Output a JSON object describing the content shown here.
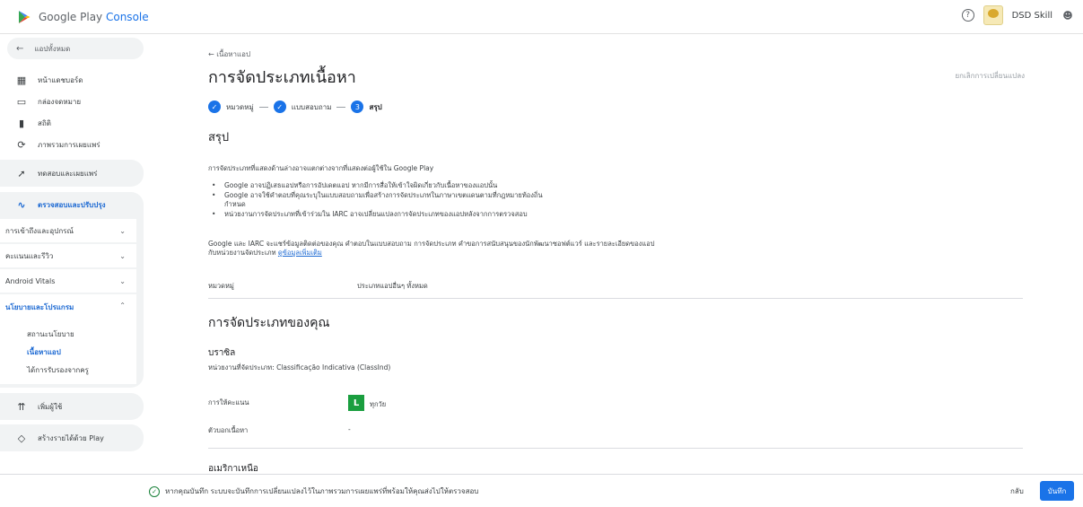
{
  "app": {
    "brand": "Google Play ",
    "brand_accent": "Console"
  },
  "account": {
    "name": "DSD Skill"
  },
  "sidebar": {
    "back_label": "แอปทั้งหมด",
    "items": [
      {
        "label": "หน้าแดชบอร์ด",
        "icon": "dashboard-icon"
      },
      {
        "label": "กล่องจดหมาย",
        "icon": "inbox-icon"
      },
      {
        "label": "สถิติ",
        "icon": "stats-icon"
      },
      {
        "label": "ภาพรวมการเผยแพร่",
        "icon": "publishing-overview-icon"
      }
    ],
    "test_release": "ทดสอบและเผยแพร่",
    "monitor_improve": "ตรวจสอบและปรับปรุง",
    "reach_devices": "การเข้าถึงและอุปกรณ์",
    "ratings_reviews": "คะแนนและรีวิว",
    "android_vitals": "Android Vitals",
    "policy_programs": "นโยบายและโปรแกรม",
    "policy_status": "สถานะนโยบาย",
    "app_content": "เนื้อหาแอป",
    "teacher_approved": "ได้การรับรองจากครู",
    "grow_users": "เพิ่มผู้ใช้",
    "monetize": "สร้างรายได้ด้วย Play"
  },
  "main": {
    "breadcrumb": "เนื้อหาแอป",
    "title": "การจัดประเภทเนื้อหา",
    "discard": "ยกเลิกการเปลี่ยนแปลง",
    "steps": [
      {
        "label": "หมวดหมู่",
        "state": "done"
      },
      {
        "label": "แบบสอบถาม",
        "state": "done"
      },
      {
        "label": "สรุป",
        "state": "current",
        "number": "3"
      }
    ],
    "summary_title": "สรุป",
    "intro": "การจัดประเภทที่แสดงด้านล่างอาจแตกต่างจากที่แสดงต่อผู้ใช้ใน Google Play",
    "bullets": [
      "Google อาจปฏิเสธแอปหรือการอัปเดตแอป หากมีการสื่อให้เข้าใจผิดเกี่ยวกับเนื้อหาของแอปนั้น",
      "Google อาจใช้คำตอบที่คุณระบุในแบบสอบถามเพื่อสร้างการจัดประเภทในภาษาเขตแดนตามที่กฎหมายท้องถิ่นกำหนด",
      "หน่วยงานการจัดประเภทที่เข้าร่วมใน IARC อาจเปลี่ยนแปลงการจัดประเภทของแอปหลังจากการตรวจสอบ"
    ],
    "share_note": "Google และ IARC จะแชร์ข้อมูลติดต่อของคุณ คำตอบในแบบสอบถาม การจัดประเภท คำขอการสนับสนุนของนักพัฒนาซอฟต์แวร์ และรายละเอียดของแอป",
    "share_note2": "กับหน่วยงานจัดประเภท ",
    "learn_more": "ดูข้อมูลเพิ่มเติม",
    "category_label": "หมวดหมู่",
    "category_value": "ประเภทแอปอื่นๆ ทั้งหมด",
    "your_ratings_title": "การจัดประเภทของคุณ",
    "brazil": {
      "country": "บราซิล",
      "authority": "หน่วยงานที่จัดประเภท: Classificação Indicativa (ClassInd)",
      "rating_label": "การให้คะแนน",
      "rating_badge": "L",
      "rating_value": "ทุกวัย",
      "descriptors_label": "ตัวบอกเนื้อหา",
      "descriptors_value": "-"
    },
    "north_america": "อเมริกาเหนือ"
  },
  "footer": {
    "message": "หากคุณบันทึก ระบบจะบันทึกการเปลี่ยนแปลงไว้ในภาพรวมการเผยแพร่ที่พร้อมให้คุณส่งไปให้ตรวจสอบ",
    "back": "กลับ",
    "save": "บันทึก"
  },
  "colors": {
    "accent": "#1a73e8",
    "rating_green": "#1a9e3f",
    "nav_active": "#1967d2"
  }
}
